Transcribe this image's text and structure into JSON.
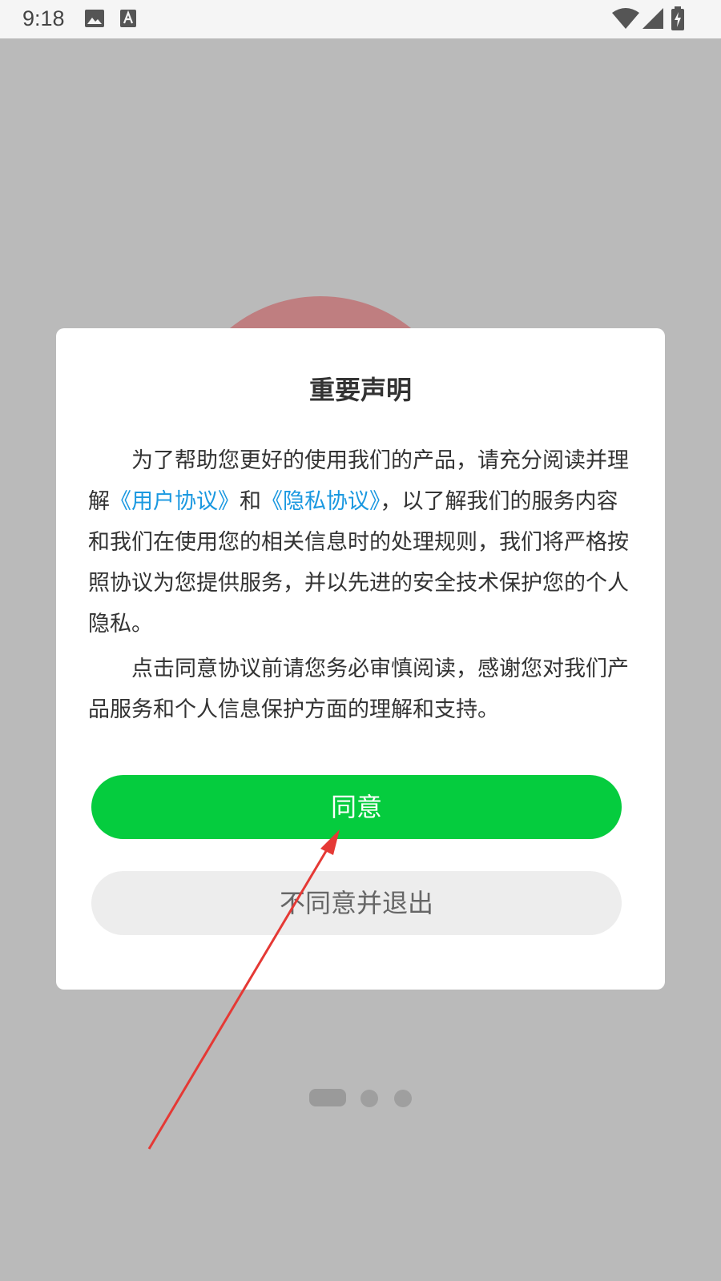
{
  "status_bar": {
    "time": "9:18",
    "icons": [
      "image-icon",
      "text-icon",
      "wifi-icon",
      "signal-icon",
      "battery-charging-icon"
    ]
  },
  "dialog": {
    "title": "重要声明",
    "para1": {
      "text_a": "为了帮助您更好的使用我们的产品，请充分阅读并理解",
      "link_user_agreement": "《用户协议》",
      "text_and": "和",
      "link_privacy_agreement": "《隐私协议》",
      "text_b": "，以了解我们的服务内容和我们在使用您的相关信息时的处理规则，我们将严格按照协议为您提供服务，并以先进的安全技术保护您的个人隐私。"
    },
    "para2": "点击同意协议前请您务必审慎阅读，感谢您对我们产品服务和个人信息保护方面的理解和支持。",
    "agree_button": "同意",
    "disagree_button": "不同意并退出"
  },
  "pager": {
    "pages": 3,
    "active_index": 0
  },
  "colors": {
    "agree_button": "#05cc3e",
    "link": "#1a98e0",
    "overlay": "#bababa",
    "annotation_arrow": "#e53935"
  }
}
